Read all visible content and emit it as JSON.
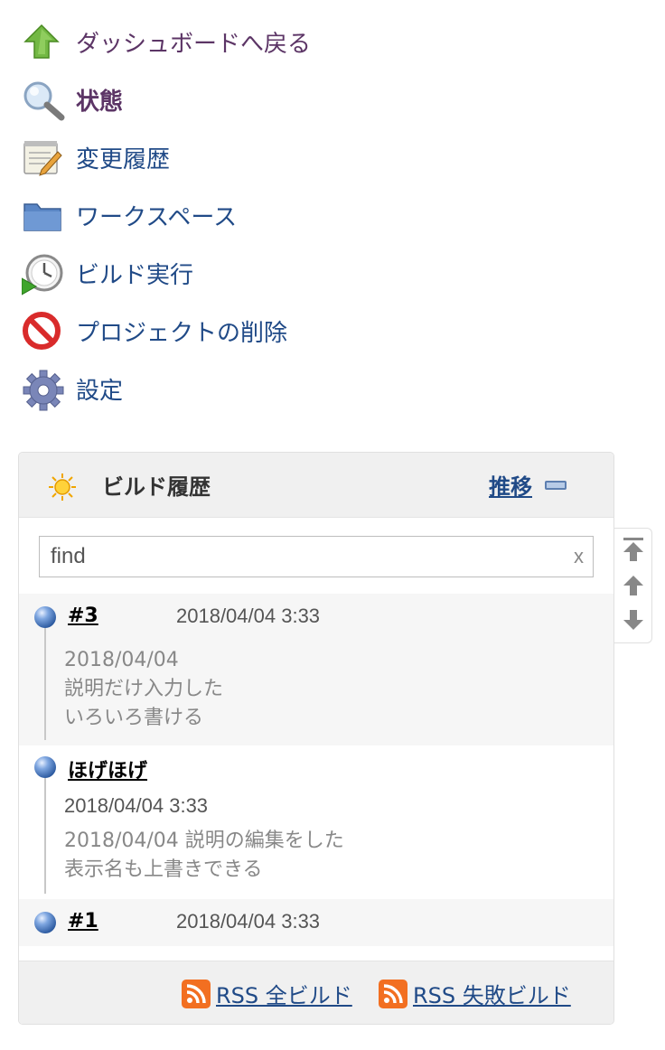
{
  "nav": {
    "items": [
      {
        "label": "ダッシュボードへ戻る",
        "icon": "up-arrow-icon"
      },
      {
        "label": "状態",
        "icon": "magnifier-icon"
      },
      {
        "label": "変更履歴",
        "icon": "notepad-icon"
      },
      {
        "label": "ワークスペース",
        "icon": "folder-icon"
      },
      {
        "label": "ビルド実行",
        "icon": "clock-play-icon"
      },
      {
        "label": "プロジェクトの削除",
        "icon": "no-entry-icon"
      },
      {
        "label": "設定",
        "icon": "gear-icon"
      }
    ]
  },
  "build_history": {
    "title": "ビルド履歴",
    "trend_label": "推移",
    "search": {
      "value": "find",
      "clear_label": "x"
    },
    "builds": [
      {
        "id": "#3",
        "time": "2018/04/04 3:33",
        "description_lines": [
          "2018/04/04",
          "説明だけ入力した",
          "いろいろ書ける"
        ]
      },
      {
        "id": "ほげほげ",
        "time": "2018/04/04 3:33",
        "description_lines": [
          "2018/04/04 説明の編集をした",
          "表示名も上書きできる"
        ]
      },
      {
        "id": "#1",
        "time": "2018/04/04 3:33",
        "description_lines": []
      }
    ],
    "footer": {
      "rss_all": "RSS 全ビルド",
      "rss_failed": "RSS 失敗ビルド"
    },
    "status_color": "#3465a4"
  },
  "colors": {
    "link": "#204a87",
    "visited": "#5c3566",
    "rss": "#f26f21"
  }
}
